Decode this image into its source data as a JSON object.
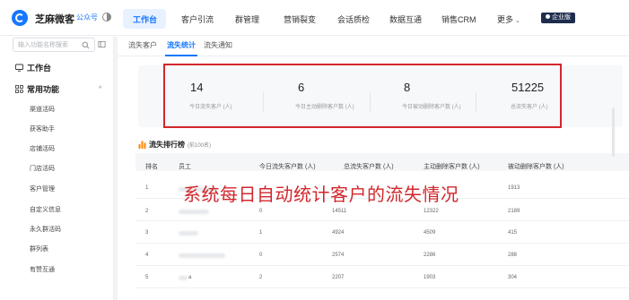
{
  "app": {
    "brand": "芝麻微客",
    "brand_tag": "公众号",
    "enterprise_badge": "企业版"
  },
  "nav": {
    "items": [
      {
        "label": "工作台",
        "active": true
      },
      {
        "label": "客户引流"
      },
      {
        "label": "群管理"
      },
      {
        "label": "营销裂变"
      },
      {
        "label": "会话质检"
      },
      {
        "label": "数据互通"
      },
      {
        "label": "销售CRM"
      },
      {
        "label": "更多"
      }
    ]
  },
  "sidebar": {
    "search_placeholder": "输入功能名称搜索",
    "workbench": "工作台",
    "common_functions": "常用功能",
    "items": [
      {
        "label": "渠道活码"
      },
      {
        "label": "获客助手"
      },
      {
        "label": "店铺活码"
      },
      {
        "label": "门店活码"
      },
      {
        "label": "客户管理"
      },
      {
        "label": "自定义信息"
      },
      {
        "label": "永久群活码"
      },
      {
        "label": "群列表"
      },
      {
        "label": "有赞互通"
      }
    ]
  },
  "tabs": [
    {
      "label": "流失客户"
    },
    {
      "label": "流失统计",
      "active": true
    },
    {
      "label": "流失通知"
    }
  ],
  "stats": [
    {
      "value": "14",
      "label": "今日流失客户 (人)"
    },
    {
      "value": "6",
      "label": "今日主动删除客户数 (人)"
    },
    {
      "value": "8",
      "label": "今日被动删除客户数 (人)"
    },
    {
      "value": "51225",
      "label": "总流失客户 (人)"
    }
  ],
  "ranking": {
    "title": "流失排行榜",
    "subtitle": "(前100名)",
    "columns": [
      "排名",
      "员工",
      "今日流失客户数 (人)",
      "总流失客户数 (人)",
      "主动删除客户数 (人)",
      "被动删除客户数 (人)"
    ],
    "rows": [
      {
        "rank": "1",
        "employee": "",
        "today": "",
        "total": "",
        "active": "",
        "passive": "1913"
      },
      {
        "rank": "2",
        "employee": "",
        "today": "0",
        "total": "14511",
        "active": "12322",
        "passive": "2189"
      },
      {
        "rank": "3",
        "employee": "",
        "today": "1",
        "total": "4924",
        "active": "4509",
        "passive": "415"
      },
      {
        "rank": "4",
        "employee": "",
        "today": "0",
        "total": "2574",
        "active": "2286",
        "passive": "288"
      },
      {
        "rank": "5",
        "employee": "a",
        "today": "2",
        "total": "2207",
        "active": "1903",
        "passive": "304"
      }
    ]
  },
  "overlay_caption": "系统每日自动统计客户的流失情况",
  "colors": {
    "accent": "#1677ff",
    "highlight_red": "#d2272c",
    "badge_bg": "#1f2d4d",
    "chart_icon": "#ff8a00"
  },
  "icons": {
    "logo": "logo-icon",
    "theme": "theme-toggle-icon",
    "search": "search-icon",
    "collapse": "collapse-icon",
    "workbench": "monitor-icon",
    "functions": "grid-icon",
    "ranking": "bar-chart-icon"
  }
}
